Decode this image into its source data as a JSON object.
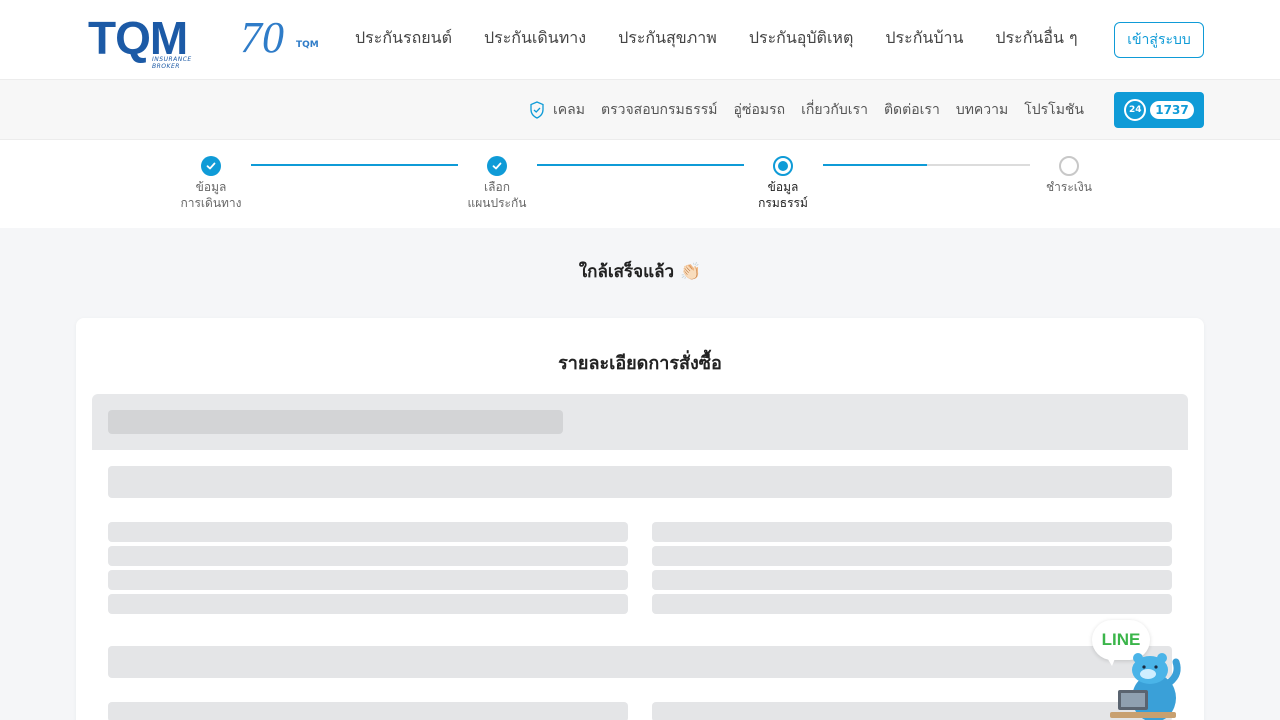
{
  "brand": {
    "logo_text": "TQM",
    "logo_sub": "INSURANCE BROKER",
    "anniversary_text": "70",
    "anniversary_sub": "TQM"
  },
  "main_nav": [
    {
      "label": "ประกันรถยนต์"
    },
    {
      "label": "ประกันเดินทาง"
    },
    {
      "label": "ประกันสุขภาพ"
    },
    {
      "label": "ประกันอุบัติเหตุ"
    },
    {
      "label": "ประกันบ้าน"
    },
    {
      "label": "ประกันอื่น ๆ"
    }
  ],
  "login_label": "เข้าสู่ระบบ",
  "sub_nav": {
    "claim_label": "เคลม",
    "items": [
      {
        "label": "ตรวจสอบกรมธรรม์"
      },
      {
        "label": "อู่ซ่อมรถ"
      },
      {
        "label": "เกี่ยวกับเรา"
      },
      {
        "label": "ติดต่อเรา"
      },
      {
        "label": "บทความ"
      },
      {
        "label": "โปรโมชัน"
      }
    ],
    "hotline_24": "24",
    "hotline_number": "1737"
  },
  "stepper": {
    "steps": [
      {
        "line1": "ข้อมูล",
        "line2": "การเดินทาง",
        "state": "done"
      },
      {
        "line1": "เลือก",
        "line2": "แผนประกัน",
        "state": "done"
      },
      {
        "line1": "ข้อมูล",
        "line2": "กรมธรรม์",
        "state": "current"
      },
      {
        "line1": "ชำระเงิน",
        "line2": "",
        "state": "todo"
      }
    ],
    "progress_third_segment": 0.5
  },
  "page_heading": "ใกล้เสร็จแล้ว 👏🏻",
  "card": {
    "title": "รายละเอียดการสั่งซื้อ"
  },
  "line_widget": {
    "label": "LINE"
  },
  "colors": {
    "accent": "#0f9bd7",
    "brand_blue": "#1c5aa6",
    "line_green": "#3bb54a"
  }
}
